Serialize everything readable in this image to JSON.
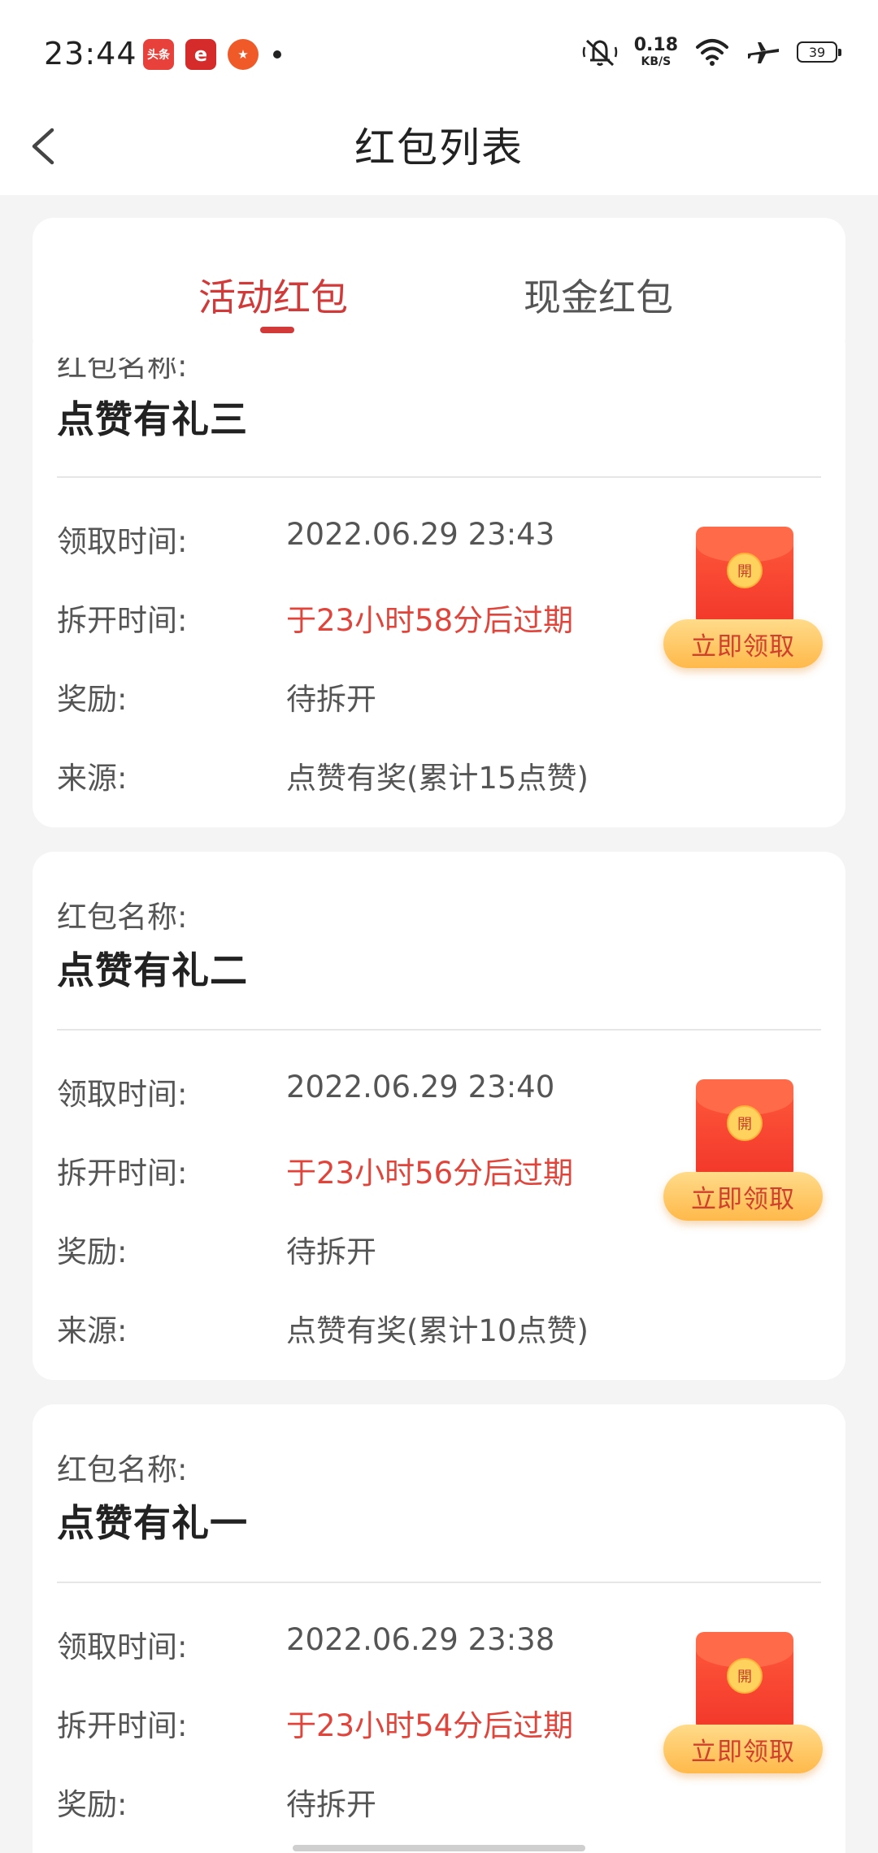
{
  "status_bar": {
    "time": "23:44",
    "net_speed_value": "0.18",
    "net_speed_unit": "KB/S",
    "battery": "39",
    "notifications": {
      "toutiao": "头条",
      "epaper": "e",
      "game": "★"
    }
  },
  "header": {
    "title": "红包列表"
  },
  "tabs": [
    {
      "label": "活动红包",
      "active": true
    },
    {
      "label": "现金红包",
      "active": false
    }
  ],
  "labels": {
    "name": "红包名称:",
    "receive_time": "领取时间:",
    "open_time": "拆开时间:",
    "reward": "奖励:",
    "source": "来源:",
    "claim_button": "立即领取",
    "seal_char": "開"
  },
  "cards": [
    {
      "name": "点赞有礼三",
      "receive_time": "2022.06.29 23:43",
      "open_time": "于23小时58分后过期",
      "reward": "待拆开",
      "source": "点赞有奖(累计15点赞)"
    },
    {
      "name": "点赞有礼二",
      "receive_time": "2022.06.29 23:40",
      "open_time": "于23小时56分后过期",
      "reward": "待拆开",
      "source": "点赞有奖(累计10点赞)"
    },
    {
      "name": "点赞有礼一",
      "receive_time": "2022.06.29 23:38",
      "open_time": "于23小时54分后过期",
      "reward": "待拆开",
      "source": ""
    }
  ],
  "colors": {
    "accent_red": "#d23a3a",
    "expiry_red": "#e0443a",
    "claim_button": "#ffc861",
    "background": "#f4f4f4"
  }
}
